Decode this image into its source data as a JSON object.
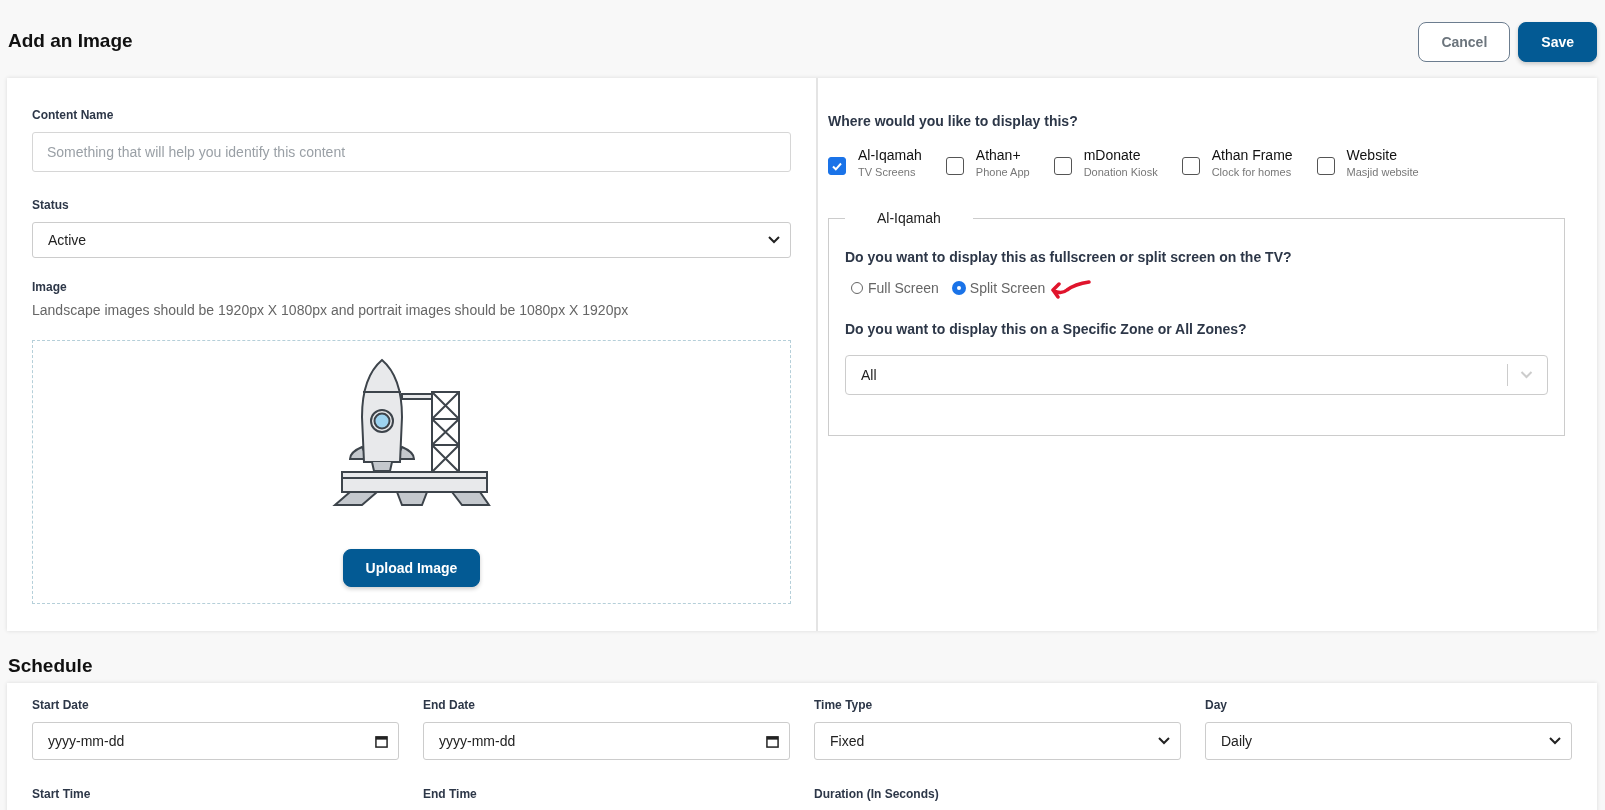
{
  "page_title": "Add an Image",
  "header_buttons": [
    {
      "label": "Cancel",
      "kind": "secondary"
    },
    {
      "label": "Save",
      "kind": "primary"
    }
  ],
  "content_name": {
    "label": "Content Name",
    "placeholder": "Something that will help you identify this content"
  },
  "status": {
    "label": "Status",
    "value": "Active"
  },
  "image": {
    "label": "Image",
    "hint": "Landscape images should be 1920px X 1080px and portrait images should be 1080px X 1920px",
    "button": "Upload Image"
  },
  "display": {
    "question": "Where would you like to display this?",
    "targets": [
      {
        "name": "Al-Iqamah",
        "subtitle": "TV Screens",
        "checked": true
      },
      {
        "name": "Athan+",
        "subtitle": "Phone App",
        "checked": false
      },
      {
        "name": "mDonate",
        "subtitle": "Donation Kiosk",
        "checked": false
      },
      {
        "name": "Athan Frame",
        "subtitle": "Clock for homes",
        "checked": false
      },
      {
        "name": "Website",
        "subtitle": "Masjid website",
        "checked": false
      }
    ]
  },
  "al_iqamah": {
    "legend": "Al-Iqamah",
    "layout_question": "Do you want to display this as fullscreen or split screen on the TV?",
    "layout_options": [
      {
        "label": "Full Screen",
        "selected": false
      },
      {
        "label": "Split Screen",
        "selected": true
      }
    ],
    "zone_question": "Do you want to display this on a Specific Zone or All Zones?",
    "zone_value": "All"
  },
  "schedule": {
    "title": "Schedule",
    "fields": [
      {
        "label": "Start Date",
        "kind": "date",
        "placeholder": "yyyy-mm-dd"
      },
      {
        "label": "End Date",
        "kind": "date",
        "placeholder": "yyyy-mm-dd"
      },
      {
        "label": "Time Type",
        "kind": "select",
        "value": "Fixed"
      },
      {
        "label": "Day",
        "kind": "select",
        "value": "Daily"
      },
      {
        "label": "Start Time",
        "kind": "label"
      },
      {
        "label": "End Time",
        "kind": "label"
      },
      {
        "label": "Duration (In Seconds)",
        "kind": "label"
      }
    ]
  }
}
